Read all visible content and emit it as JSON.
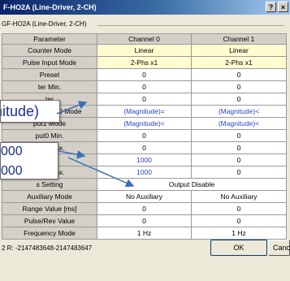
{
  "window": {
    "title": "F-HO2A (Line-Driver, 2-CH)",
    "subtitle": "GF-HO2A (Line-Driver, 2-CH)",
    "help_label": "?",
    "close_label": "×"
  },
  "table": {
    "headers": [
      "Parameter",
      "Channel 0",
      "Channel 1"
    ],
    "rows": [
      [
        "Counter Mode",
        "Linear",
        "Linear"
      ],
      [
        "Pulse Input Mode",
        "2-Phs x1",
        "2-Phs x1"
      ],
      [
        "Preset",
        "0",
        "0"
      ],
      [
        "ter Min.",
        "0",
        "0"
      ],
      [
        "ter",
        "0",
        "0"
      ],
      [
        "Comp Output0 Mode",
        "(Magnitude)=",
        "(Magnitude)<"
      ],
      [
        "put1 Mode",
        "(Magnitude)<",
        "(Magnitude)<"
      ],
      [
        "put0 Min.",
        "0",
        "0"
      ],
      [
        "put0 Max.",
        "0",
        "0"
      ],
      [
        "put1",
        "1000",
        "0"
      ],
      [
        "put1 Max.",
        "1000",
        "0"
      ],
      [
        "s Setting",
        "Output Disable"
      ],
      [
        "Auxiliary Mode",
        "No Auxiliary",
        "No Auxiliary"
      ],
      [
        "Range Value [ms]",
        "0",
        "0"
      ],
      [
        "Pulse/Rev Value",
        "0",
        "0"
      ],
      [
        "Frequency Mode",
        "1 Hz",
        "1 Hz"
      ]
    ]
  },
  "status_text": "2 R: -2147483648-2147483647",
  "buttons": {
    "ok": "OK",
    "cancel": "Cancel"
  },
  "zoom_callouts": {
    "magnitude": "nitude)",
    "value_a": "000",
    "value_b": "000"
  },
  "colors": {
    "title_bar": "#0a246a",
    "highlight_cell": "#fffccf",
    "value_text": "#2b3fc6",
    "arrow": "#3a6fb5"
  }
}
